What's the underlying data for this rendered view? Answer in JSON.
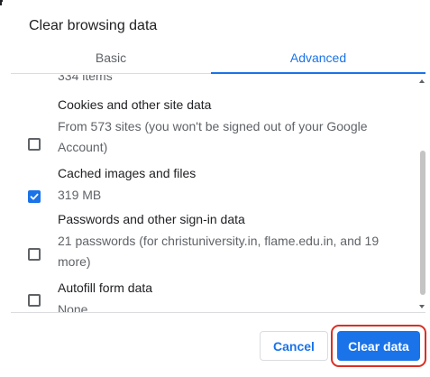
{
  "dialog": {
    "title": "Clear browsing data"
  },
  "tabs": [
    {
      "label": "Basic",
      "selected": false
    },
    {
      "label": "Advanced",
      "selected": true
    }
  ],
  "partial_above": "334 items",
  "options": [
    {
      "label": "Cookies and other site data",
      "detail": "From 573 sites (you won't be signed out of your Google Account)",
      "checked": false
    },
    {
      "label": "Cached images and files",
      "detail": "319 MB",
      "checked": true
    },
    {
      "label": "Passwords and other sign-in data",
      "detail": "21 passwords (for christuniversity.in, flame.edu.in, and 19 more)",
      "checked": false
    },
    {
      "label": "Autofill form data",
      "detail": "None",
      "checked": false
    }
  ],
  "buttons": {
    "cancel": "Cancel",
    "clear": "Clear data"
  },
  "colors": {
    "accent": "#1a73e8",
    "highlight": "#d93025",
    "text_primary": "#202124",
    "text_secondary": "#5f6368"
  },
  "icons": {
    "checkmark": "check-icon"
  }
}
